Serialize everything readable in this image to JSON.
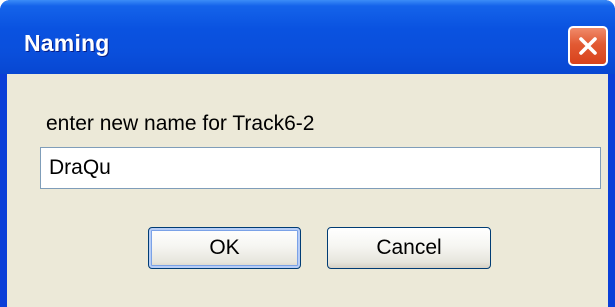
{
  "window": {
    "title": "Naming",
    "close_icon": "close-icon"
  },
  "dialog": {
    "prompt": "enter new name for Track6-2",
    "name_value": "DraQu",
    "ok_label": "OK",
    "cancel_label": "Cancel"
  },
  "colors": {
    "titlebar": "#0a52e0",
    "close_button": "#e25a33",
    "client_background": "#ece9d8",
    "input_border": "#7f9db9",
    "button_border": "#003c74"
  }
}
